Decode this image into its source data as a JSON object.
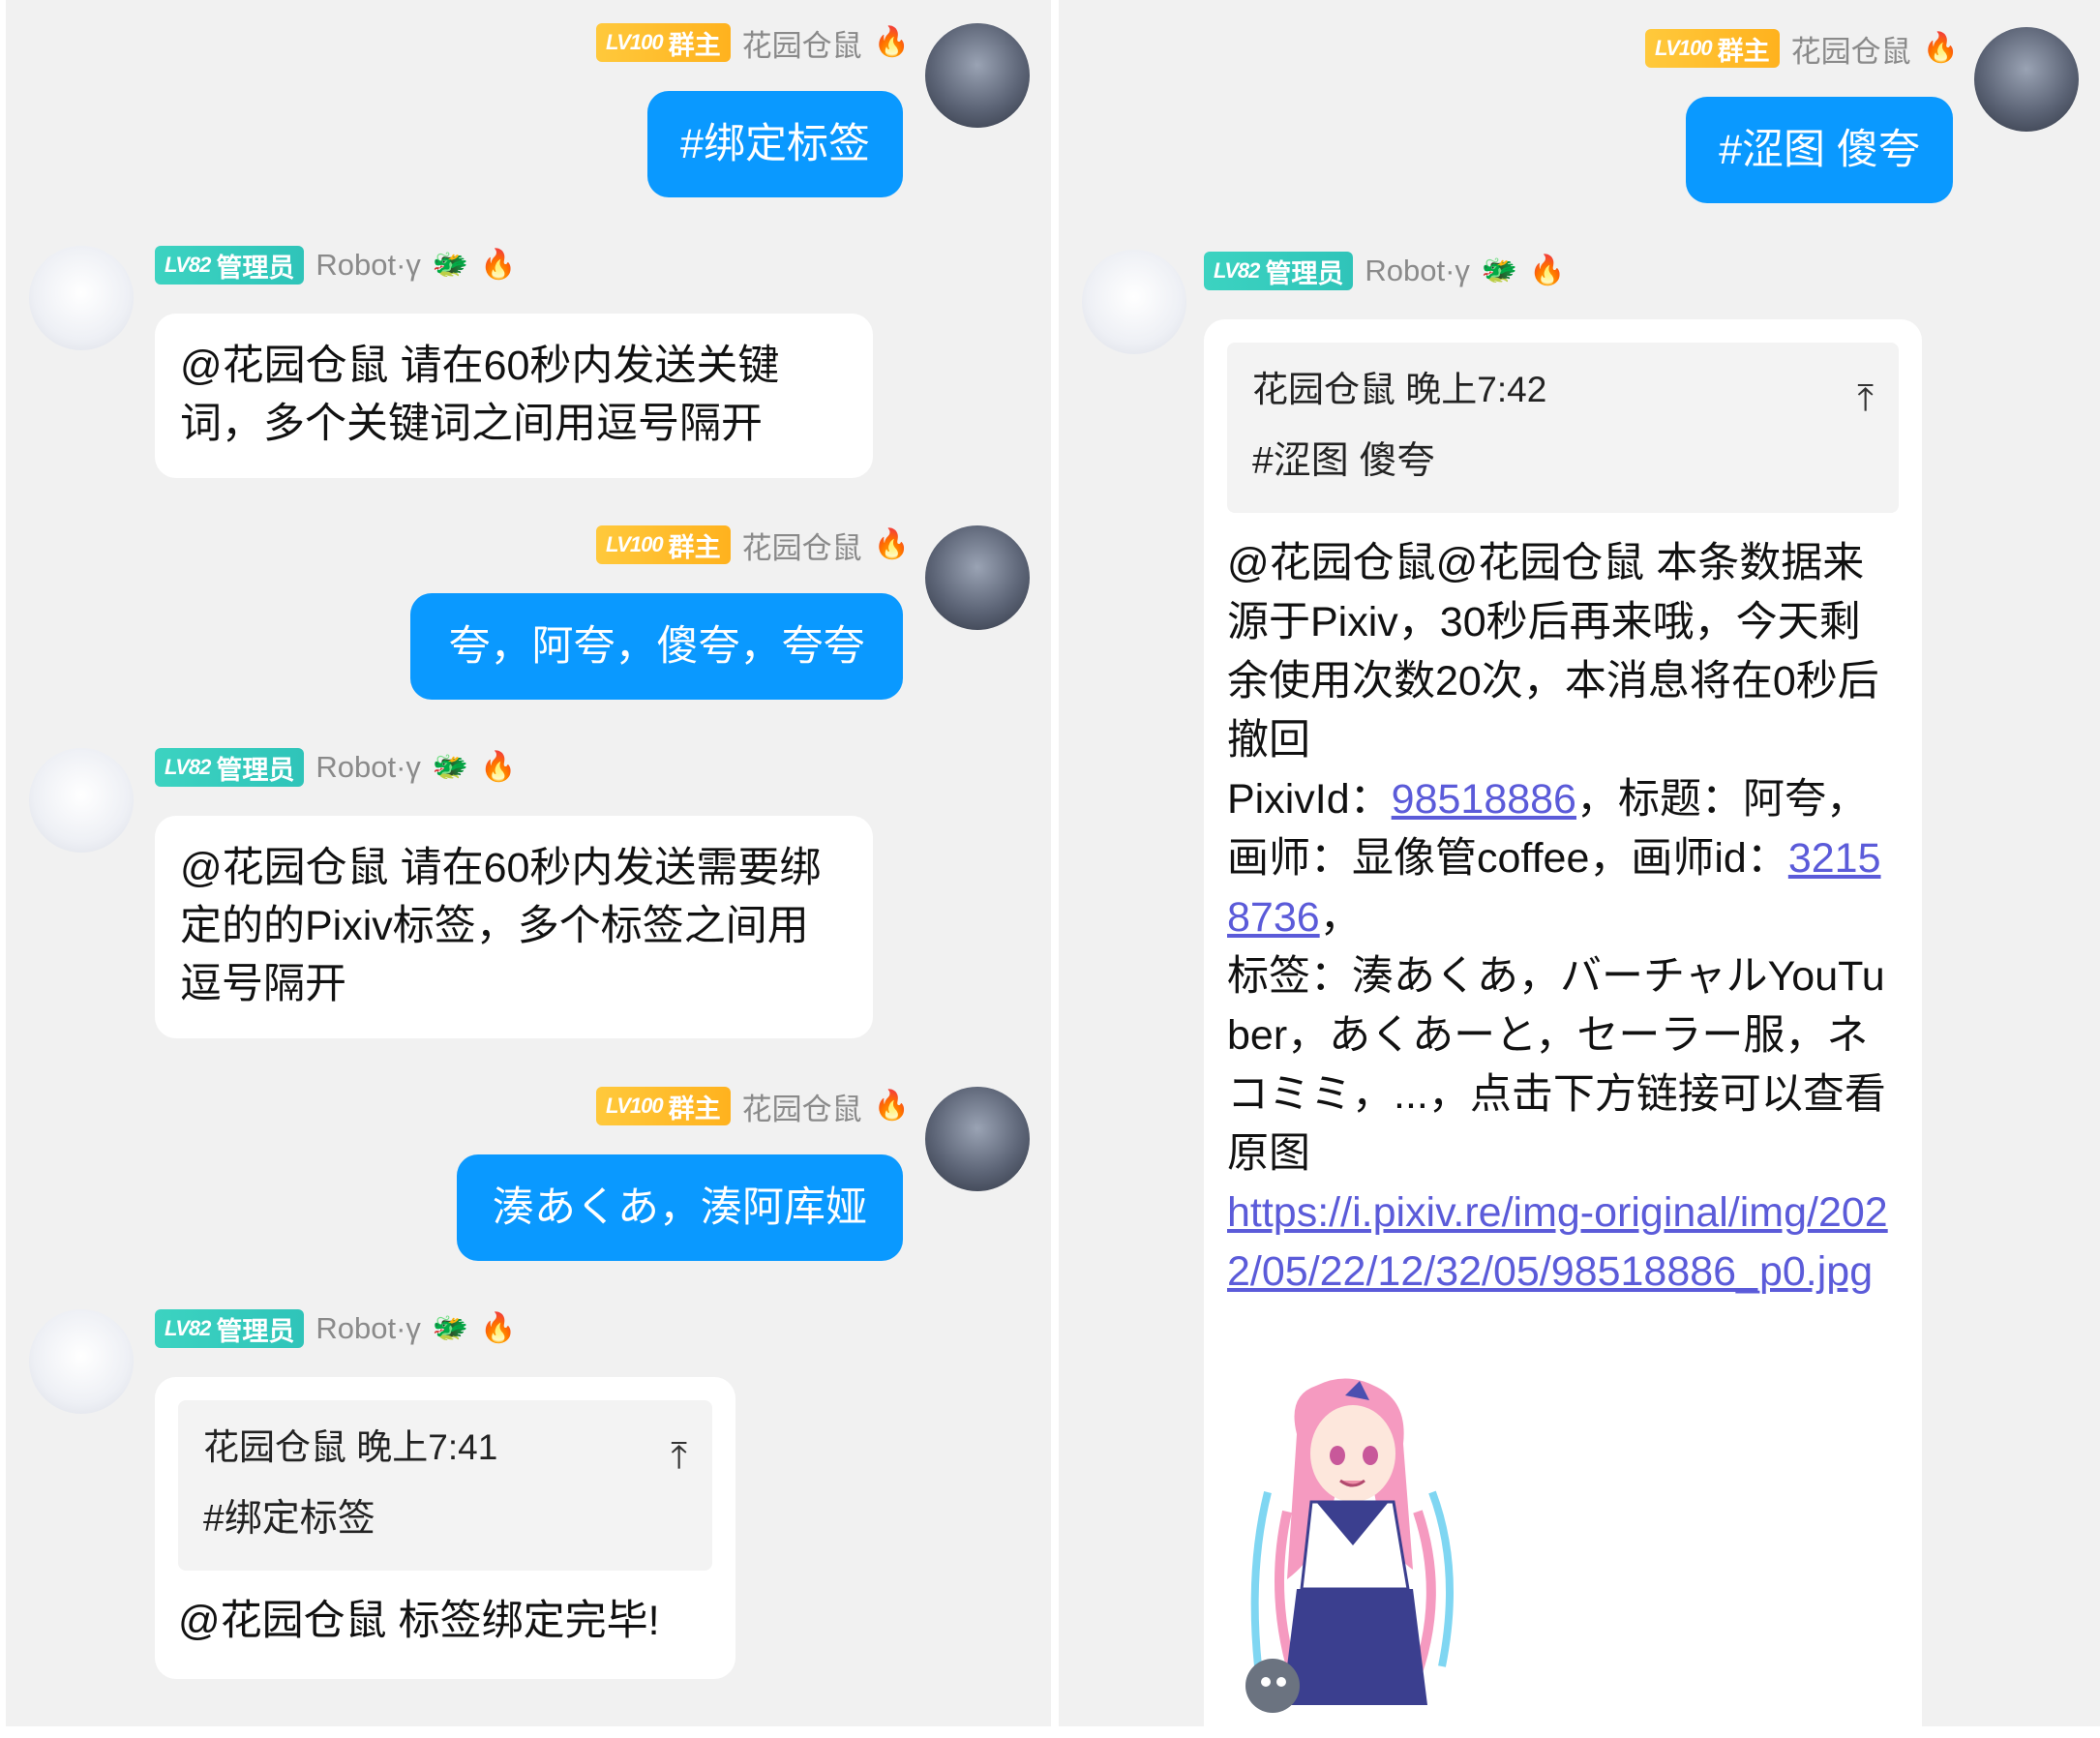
{
  "owner": {
    "level": "LV100",
    "role": "群主",
    "nick": "花园仓鼠",
    "flag": "🔥"
  },
  "bot": {
    "level": "LV82",
    "role": "管理员",
    "nick": "Robot·γ",
    "flag1": "🐲",
    "flag2": "🔥"
  },
  "left": {
    "m1": "#绑定标签",
    "m2": "@花园仓鼠 请在60秒内发送关键词，多个关键词之间用逗号隔开",
    "m3": "夸，阿夸，傻夸，夸夸",
    "m4": "@花园仓鼠 请在60秒内发送需要绑定的的Pixiv标签，多个标签之间用逗号隔开",
    "m5": "湊あくあ，湊阿库娅",
    "m6": {
      "quote_head": "花园仓鼠 晚上7:41",
      "quote_text": "#绑定标签",
      "quote_icon": "⤒",
      "text": "@花园仓鼠 标签绑定完毕!"
    }
  },
  "right": {
    "m1": "#涩图 傻夸",
    "m2": {
      "quote_head": "花园仓鼠 晚上7:42",
      "quote_text": "#涩图 傻夸",
      "quote_icon": "⤒",
      "t1": "@花园仓鼠@花园仓鼠 本条数据来源于Pixiv，30秒后再来哦，今天剩余使用次数20次，本消息将在0秒后撤回",
      "t2": "PixivId：",
      "pid": "98518886",
      "t3": "，标题：阿夸，画师：显像管coffee，画师id：",
      "uid": "32158736",
      "t4": "，",
      "t5": "标签：湊あくあ，バーチャルYouTuber，あくあーと，セーラー服，ネコミミ，...，点击下方链接可以查看原图",
      "url": "https://i.pixiv.re/img-original/img/2022/05/22/12/32/05/98518886_p0.jpg"
    }
  },
  "colors": {
    "bubble_blue": "#0a99ff",
    "link": "#5b5bd9",
    "badge_gold": "#ffb21e",
    "badge_teal": "#2fc4b9"
  }
}
